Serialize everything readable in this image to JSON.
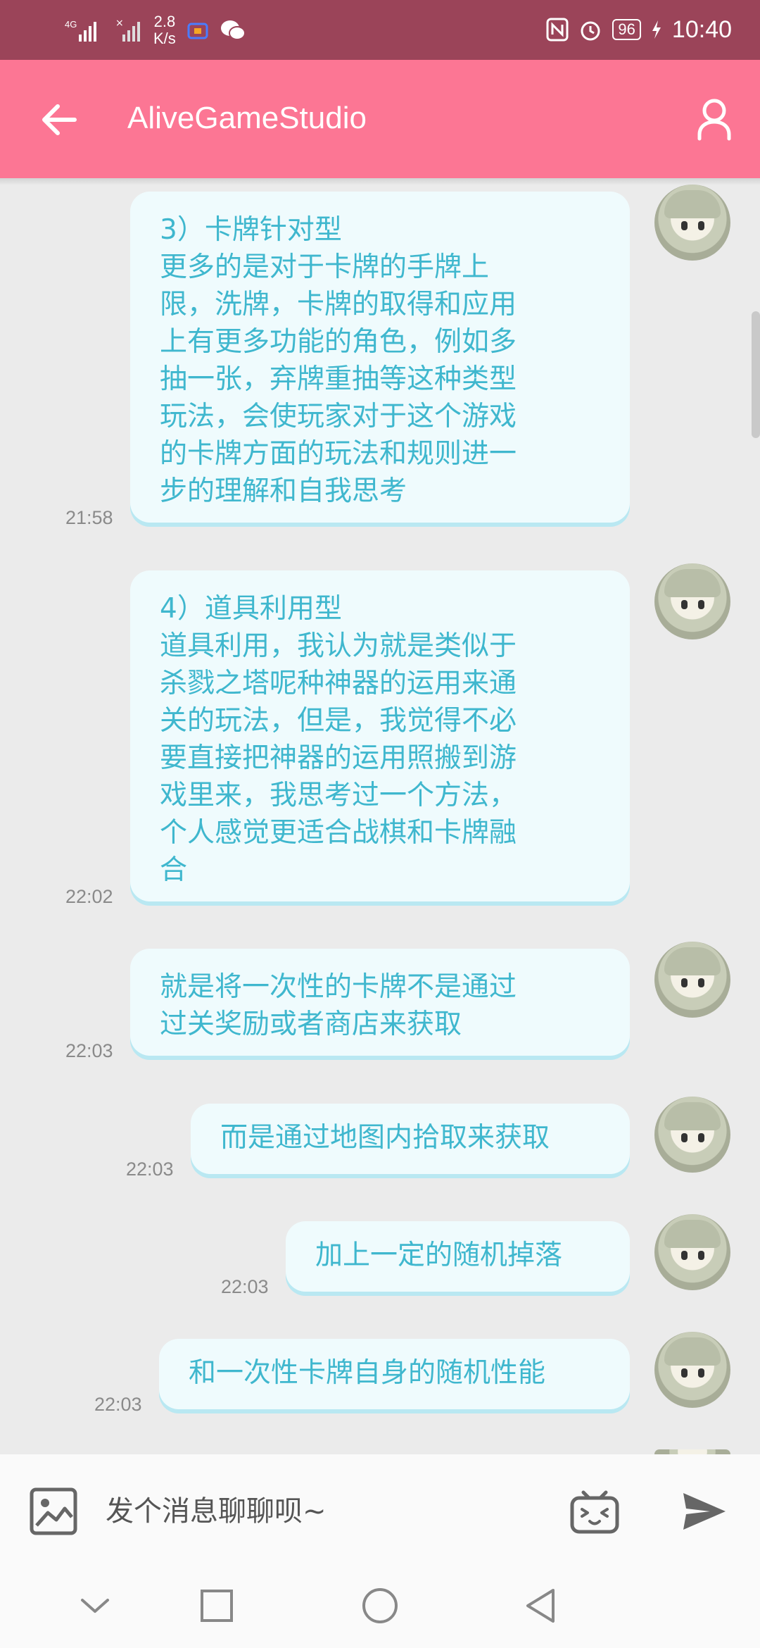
{
  "status_bar": {
    "network": "4G",
    "speed_value": "2.8",
    "speed_unit": "K/s",
    "battery": "96",
    "time": "10:40"
  },
  "app_bar": {
    "title": "AliveGameStudio",
    "back_icon": "arrow-left-icon",
    "profile_icon": "person-icon"
  },
  "messages": [
    {
      "text": "3）卡牌针对型\n更多的是对于卡牌的手牌上\n限，洗牌，卡牌的取得和应用\n上有更多功能的角色，例如多\n抽一张，弃牌重抽等这种类型\n玩法，会使玩家对于这个游戏\n的卡牌方面的玩法和规则进一\n步的理解和自我思考",
      "time": "21:58"
    },
    {
      "text": "4）道具利用型\n道具利用，我认为就是类似于\n杀戮之塔呢种神器的运用来通\n关的玩法，但是，我觉得不必\n要直接把神器的运用照搬到游\n戏里来，我思考过一个方法，\n个人感觉更适合战棋和卡牌融\n合",
      "time": "22:02"
    },
    {
      "text": "就是将一次性的卡牌不是通过\n过关奖励或者商店来获取",
      "time": "22:03"
    },
    {
      "text": "而是通过地图内拾取来获取",
      "time": "22:03"
    },
    {
      "text": "加上一定的随机掉落",
      "time": "22:03"
    },
    {
      "text": "和一次性卡牌自身的随机性能",
      "time": "22:03"
    }
  ],
  "input_bar": {
    "placeholder": "发个消息聊聊呗~",
    "image_icon": "image-icon",
    "emoji_icon": "bilibili-emoji-icon",
    "send_icon": "send-icon"
  },
  "colors": {
    "status_bar": "#9b4459",
    "app_bar": "#fc7694",
    "bubble_bg": "#effbfd",
    "bubble_text": "#3fb7ce",
    "background": "#ebebeb"
  }
}
